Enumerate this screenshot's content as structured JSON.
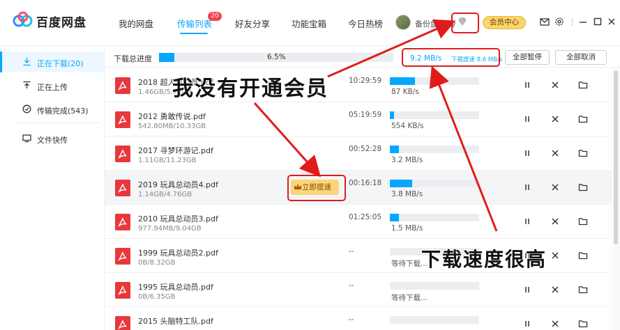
{
  "app": {
    "brand": "百度网盘"
  },
  "nav": {
    "tabs": [
      {
        "label": "我的网盘",
        "active": false
      },
      {
        "label": "传输列表",
        "active": true,
        "badge": "20"
      },
      {
        "label": "好友分享",
        "active": false
      },
      {
        "label": "功能宝箱",
        "active": false
      },
      {
        "label": "今日热榜",
        "active": false
      }
    ],
    "username": "备份盘_feiyu",
    "vip_button": "会员中心",
    "icons": [
      "mail-icon",
      "settings-icon",
      "minimize-icon",
      "maximize-icon",
      "close-icon"
    ]
  },
  "sidebar": {
    "items": [
      {
        "label": "正在下载(20)",
        "icon": "download-icon",
        "active": true
      },
      {
        "label": "正在上传",
        "icon": "upload-icon",
        "active": false
      },
      {
        "label": "传输完成(543)",
        "icon": "check-circle-icon",
        "active": false
      },
      {
        "label": "文件快传",
        "icon": "monitor-icon",
        "active": false
      }
    ]
  },
  "progress": {
    "label": "下载总进度",
    "percent_text": "6.5%",
    "fraction": 0.065,
    "speed": "9.2 MB/s",
    "boost_speed": "下载提速 8.6 MB/s",
    "pause_all": "全部暂停",
    "cancel_all": "全部取消"
  },
  "files": [
    {
      "name": "2018 超人总动员.pdf",
      "size": "1.46GB/5.74GB",
      "time": "10:29:59",
      "speed": "87 KB/s",
      "fraction": 0.28
    },
    {
      "name": "2012 勇敢传说.pdf",
      "size": "542.80MB/10.33GB",
      "time": "05:19:59",
      "speed": "554 KB/s",
      "fraction": 0.05
    },
    {
      "name": "2017 寻梦环游记.pdf",
      "size": "1.11GB/11.23GB",
      "time": "00:52:28",
      "speed": "3.2 MB/s",
      "fraction": 0.1
    },
    {
      "name": "2019 玩具总动员4.pdf",
      "size": "1.14GB/4.76GB",
      "time": "00:16:18",
      "speed": "3.8 MB/s",
      "fraction": 0.25,
      "boost": "立即提速"
    },
    {
      "name": "2010 玩具总动员3.pdf",
      "size": "977.94MB/9.04GB",
      "time": "01:25:05",
      "speed": "1.5 MB/s",
      "fraction": 0.1
    },
    {
      "name": "1999 玩具总动员2.pdf",
      "size": "0B/8.32GB",
      "time": "--",
      "speed": "等待下载...",
      "fraction": 0
    },
    {
      "name": "1995 玩具总动员.pdf",
      "size": "0B/6.35GB",
      "time": "--",
      "speed": "等待下载...",
      "fraction": 0
    },
    {
      "name": "2015 头脑特工队.pdf",
      "size": "",
      "time": "--",
      "speed": "",
      "fraction": 0
    }
  ],
  "annotations": {
    "not_member": "我没有开通会员",
    "speed_high": "下载速度很高"
  },
  "colors": {
    "accent": "#06a7ff",
    "annotation": "#e11b1b",
    "pdf": "#e7383e",
    "vip": "#f9d56c"
  }
}
